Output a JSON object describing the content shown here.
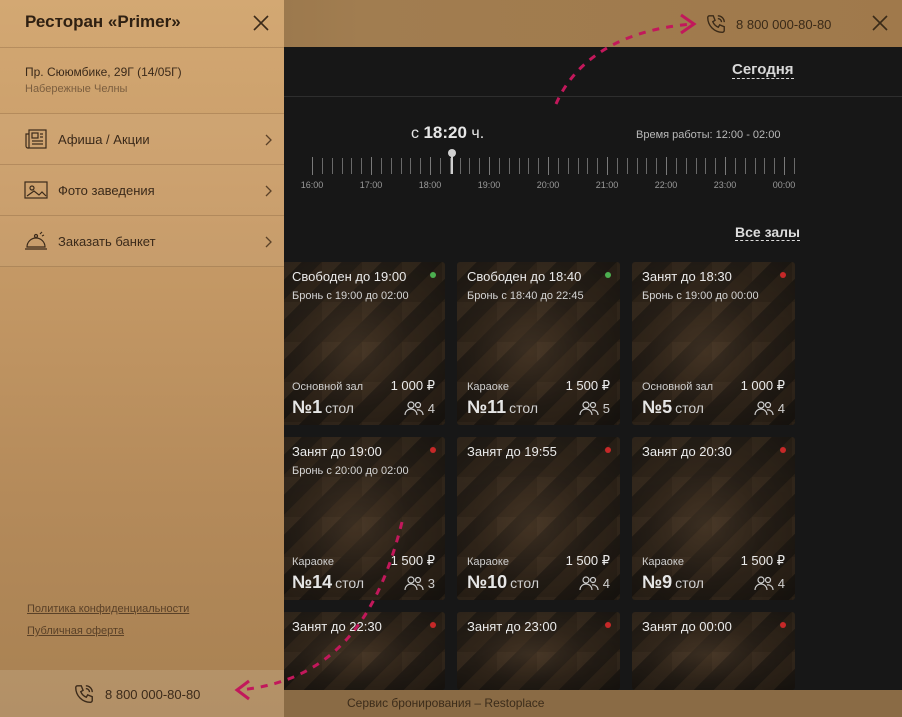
{
  "header": {
    "phone": "8 800 000-80-80",
    "close_icon": "close-icon"
  },
  "booking": {
    "today_label": "Сегодня",
    "time_prefix": "с",
    "time_value": "18:20",
    "time_suffix": "ч.",
    "work_hours": "Время работы: 12:00 - 02:00",
    "hours": [
      "16:00",
      "17:00",
      "18:00",
      "19:00",
      "20:00",
      "21:00",
      "22:00",
      "23:00",
      "00:00"
    ],
    "all_halls_label": "Все залы"
  },
  "tables": [
    {
      "status": "Свободен до 19:00",
      "booking": "Бронь с 19:00 до 02:00",
      "free": true,
      "hall": "Основной зал",
      "price": "1 000 ₽",
      "number": "№1",
      "unit": "стол",
      "seats": "4"
    },
    {
      "status": "Свободен до 18:40",
      "booking": "Бронь с 18:40 до 22:45",
      "free": true,
      "hall": "Караоке",
      "price": "1 500 ₽",
      "number": "№11",
      "unit": "стол",
      "seats": "5"
    },
    {
      "status": "Занят до 18:30",
      "booking": "Бронь с 19:00 до 00:00",
      "free": false,
      "hall": "Основной зал",
      "price": "1 000 ₽",
      "number": "№5",
      "unit": "стол",
      "seats": "4"
    },
    {
      "status": "Занят до 19:00",
      "booking": "Бронь с 20:00 до 02:00",
      "free": false,
      "hall": "Караоке",
      "price": "1 500 ₽",
      "number": "№14",
      "unit": "стол",
      "seats": "3"
    },
    {
      "status": "Занят до 19:55",
      "booking": "",
      "free": false,
      "hall": "Караоке",
      "price": "1 500 ₽",
      "number": "№10",
      "unit": "стол",
      "seats": "4"
    },
    {
      "status": "Занят до 20:30",
      "booking": "",
      "free": false,
      "hall": "Караоке",
      "price": "1 500 ₽",
      "number": "№9",
      "unit": "стол",
      "seats": "4"
    },
    {
      "status": "Занят до 22:30",
      "booking": "",
      "free": false,
      "hall": "",
      "price": "",
      "number": "",
      "unit": "",
      "seats": ""
    },
    {
      "status": "Занят до 23:00",
      "booking": "",
      "free": false,
      "hall": "",
      "price": "",
      "number": "",
      "unit": "",
      "seats": ""
    },
    {
      "status": "Занят до 00:00",
      "booking": "",
      "free": false,
      "hall": "",
      "price": "",
      "number": "",
      "unit": "",
      "seats": ""
    }
  ],
  "colors": {
    "free_indicator": "#4caf50",
    "busy_indicator": "#c62828",
    "accent_arrow": "#c2185b"
  },
  "footer": {
    "service_text": "Сервис бронирования – Restoplace"
  },
  "sidebar": {
    "title": "Ресторан «Primer»",
    "address": "Пр. Сююмбике, 29Г (14/05Г)",
    "city": "Набережные Челны",
    "menu": [
      {
        "label": "Афиша / Акции",
        "icon": "newspaper-icon"
      },
      {
        "label": "Фото заведения",
        "icon": "photo-icon"
      },
      {
        "label": "Заказать банкет",
        "icon": "cloche-icon"
      }
    ],
    "privacy_link": "Политика конфиденциальности",
    "offer_link": "Публичная оферта",
    "phone": "8 800 000-80-80"
  }
}
